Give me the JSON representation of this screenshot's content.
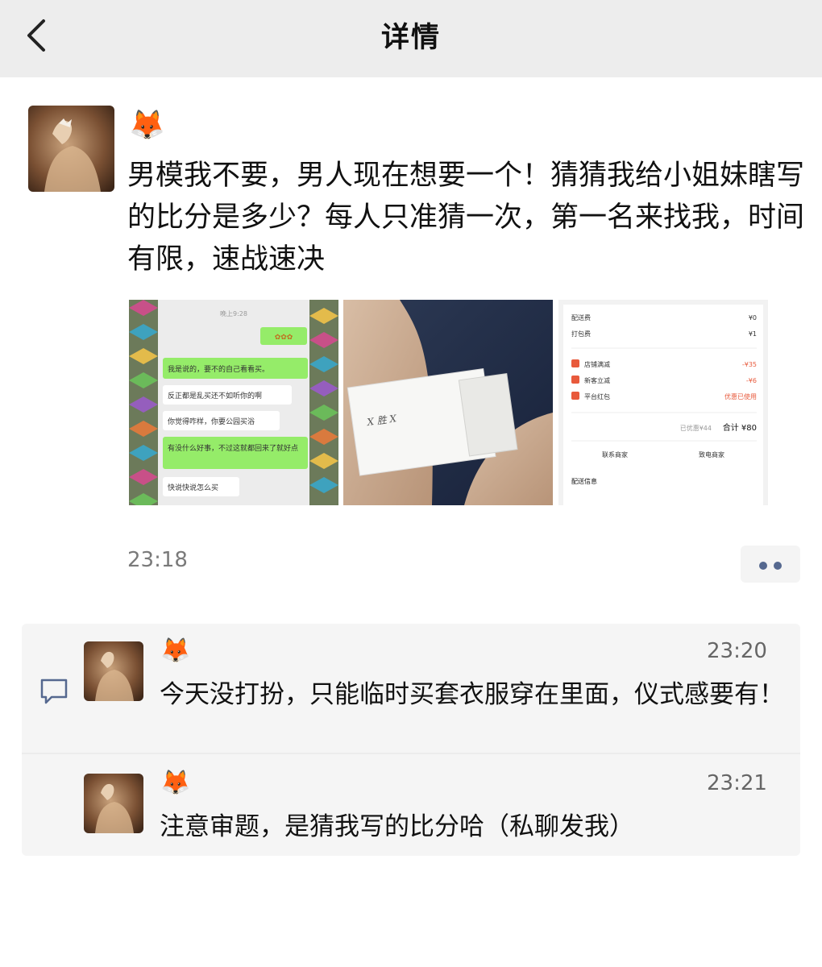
{
  "header": {
    "title": "详情"
  },
  "post": {
    "username": "🦊",
    "text": "男模我不要，男人现在想要一个！猜猜我给小姐妹瞎写的比分是多少？每人只准猜一次，第一名来找我，时间有限，速战速决",
    "time": "23:18",
    "photos": [
      {
        "kind": "chat-screenshot",
        "header": "晚上9:28",
        "sticker": "✿✿✿",
        "bubbles": [
          "我是说的，要不的自己看看买。",
          "反正都是乱买还不如听你的啊",
          "你觉得咋样，你要公园买浴",
          "有没什么好事，不过这就都回来了就好点",
          "快说快说怎么买"
        ]
      },
      {
        "kind": "handwritten-note",
        "note": "X 胜 X"
      },
      {
        "kind": "order-screenshot",
        "rows": [
          {
            "label": "配送费",
            "value": "¥0"
          },
          {
            "label": "打包费",
            "value": "¥1"
          }
        ],
        "discounts": [
          {
            "label": "店铺满减",
            "value": "-¥35"
          },
          {
            "label": "新客立减",
            "value": "-¥6"
          },
          {
            "label": "平台红包",
            "value": "优惠已使用"
          }
        ],
        "subtotal": "已优惠¥44",
        "total": "合计 ¥80",
        "actions": [
          "联系商家",
          "致电商家"
        ],
        "section": "配送信息"
      }
    ]
  },
  "comments": [
    {
      "username": "🦊",
      "time": "23:20",
      "text": "今天没打扮，只能临时买套衣服穿在里面，仪式感要有！"
    },
    {
      "username": "🦊",
      "time": "23:21",
      "text": "注意审题，是猜我写的比分哈（私聊发我）"
    }
  ],
  "colors": {
    "header_bg": "#ededed",
    "link_blue": "#55688f",
    "comment_bg": "#f5f5f5",
    "chat_green": "#95ec69"
  },
  "icons": {
    "back": "chevron-left-icon",
    "comment": "comment-bubble-icon",
    "more": "more-dots-icon"
  }
}
